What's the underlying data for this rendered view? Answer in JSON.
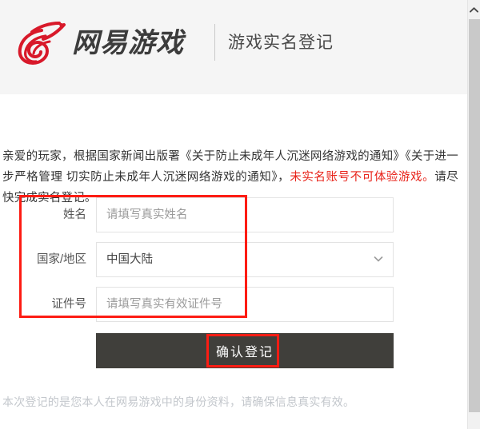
{
  "header": {
    "logo_icon": "netease-flame-logo-icon",
    "logo_text": "网易游戏",
    "subtitle": "游戏实名登记",
    "brand_red": "#d8192a",
    "background": "#f5f5f5"
  },
  "notice": {
    "text_before": "亲爱的玩家，根据国家新闻出版署《关于防止未成年人沉迷网络游戏的通知》《关于进一步严格管理 切实防止未成年人沉迷网络游戏的通知》，",
    "highlight": "未实名账号不可体验游戏。",
    "text_after": "请尽快完成实名登记。",
    "highlight_color": "#e8231a"
  },
  "form": {
    "rows": [
      {
        "label": "姓名",
        "type": "text",
        "placeholder": "请填写真实姓名",
        "value": ""
      },
      {
        "label": "国家/地区",
        "type": "select",
        "placeholder": "",
        "value": "中国大陆",
        "chevron_icon": "chevron-down-icon"
      },
      {
        "label": "证件号",
        "type": "text",
        "placeholder": "请填写真实有效证件号",
        "value": ""
      }
    ]
  },
  "submit": {
    "label": "确认登记",
    "background": "#403f3b"
  },
  "footer": {
    "note": "本次登记的是您本人在网易游戏中的身份资料，请确保信息真实有效。"
  },
  "annotations": {
    "color": "#fd1c13",
    "items": [
      {
        "name": "form-fields-highlight"
      },
      {
        "name": "submit-button-highlight"
      }
    ]
  },
  "scrollbar": {
    "up_arrow_icon": "chevron-up-icon",
    "thumb_color": "#c9c9c9",
    "track_color": "#f1f1f1"
  }
}
